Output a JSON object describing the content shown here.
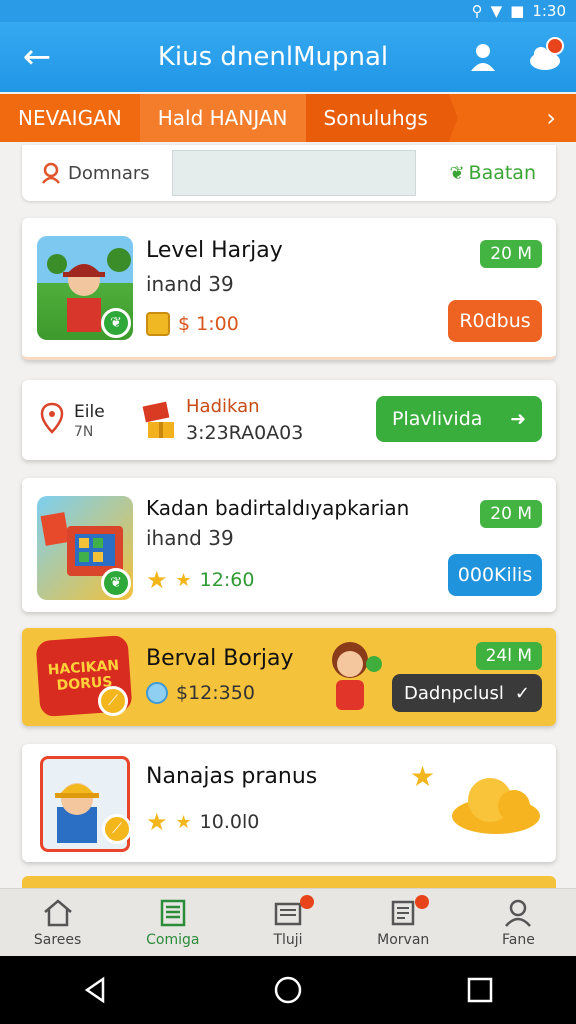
{
  "status": {
    "time": "1:30"
  },
  "appbar": {
    "title": "Kius dnenlMupnal"
  },
  "tabs": {
    "items": [
      "NEVAIGAN",
      "Hald HANJAN",
      "Sonuluhgs"
    ]
  },
  "search": {
    "label": "Domnars",
    "right_label": "Baatan"
  },
  "cards": [
    {
      "title": "Level Harjay",
      "subtitle": "inand 39",
      "price": "$ 1:00",
      "pill": "20 M",
      "button": "R0dbus"
    },
    {
      "label": "Eile",
      "sublabel": "7N",
      "title": "Hadikan",
      "code": "3:23RA0A03",
      "button": "Plavlivida"
    },
    {
      "title": "Kadan badirtaldıyapkarian",
      "subtitle": "ihand 39",
      "price": "12:60",
      "pill": "20 M",
      "button": "000Kilis"
    },
    {
      "title": "Berval Borjay",
      "price": "$12:350",
      "pill": "24l M",
      "button": "Dadnpclusl",
      "logo_text": "HACIKAN DORUS"
    },
    {
      "title": "Nanajas pranus",
      "price": "10.0l0"
    }
  ],
  "bottomnav": {
    "items": [
      "Sarees",
      "Comiga",
      "Tluji",
      "Morvan",
      "Fane"
    ]
  },
  "colors": {
    "blue": "#2196e6",
    "orange": "#f26a10",
    "green": "#43b341",
    "yellow": "#f5c33b"
  }
}
